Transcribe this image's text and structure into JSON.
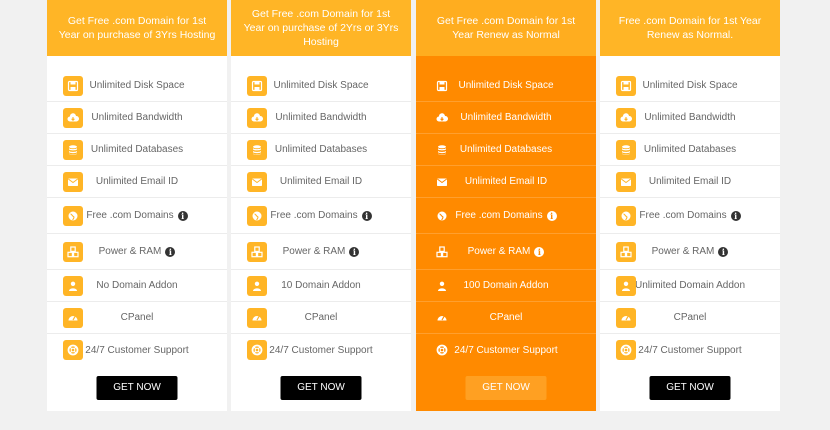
{
  "colors": {
    "accent": "#ffb526",
    "featured": "#ff8a00",
    "button": "#000000",
    "featured_button": "#ffa022",
    "background": "#f1f1f1"
  },
  "plans": [
    {
      "header": "Get Free .com Domain for 1st Year on purchase of 3Yrs Hosting",
      "features": [
        "Unlimited Disk Space",
        "Unlimited Bandwidth",
        "Unlimited Databases",
        "Unlimited Email ID",
        "Free .com Domains",
        "Power & RAM",
        "No Domain Addon",
        "CPanel",
        "24/7 Customer Support"
      ],
      "button": "GET NOW"
    },
    {
      "header": "Get Free .com Domain for 1st Year on purchase of 2Yrs or 3Yrs Hosting",
      "features": [
        "Unlimited Disk Space",
        "Unlimited Bandwidth",
        "Unlimited Databases",
        "Unlimited Email ID",
        "Free .com Domains",
        "Power & RAM",
        "10 Domain Addon",
        "CPanel",
        "24/7 Customer Support"
      ],
      "button": "GET NOW"
    },
    {
      "header": "Get Free .com Domain for 1st Year Renew as Normal",
      "features": [
        "Unlimited Disk Space",
        "Unlimited Bandwidth",
        "Unlimited Databases",
        "Unlimited Email ID",
        "Free .com Domains",
        "Power & RAM",
        "100 Domain Addon",
        "CPanel",
        "24/7 Customer Support"
      ],
      "button": "GET NOW"
    },
    {
      "header": "Free .com Domain for 1st Year Renew as Normal.",
      "features": [
        "Unlimited Disk Space",
        "Unlimited Bandwidth",
        "Unlimited Databases",
        "Unlimited Email ID",
        "Free .com Domains",
        "Power & RAM",
        "Unlimited Domain Addon",
        "CPanel",
        "24/7 Customer Support"
      ],
      "button": "GET NOW"
    }
  ],
  "feature_icons": [
    "save-icon",
    "cloud-download-icon",
    "database-icon",
    "envelope-icon",
    "globe-icon",
    "cubes-icon",
    "user-icon",
    "dashboard-icon",
    "lifebuoy-icon"
  ],
  "info_glyph": "i"
}
